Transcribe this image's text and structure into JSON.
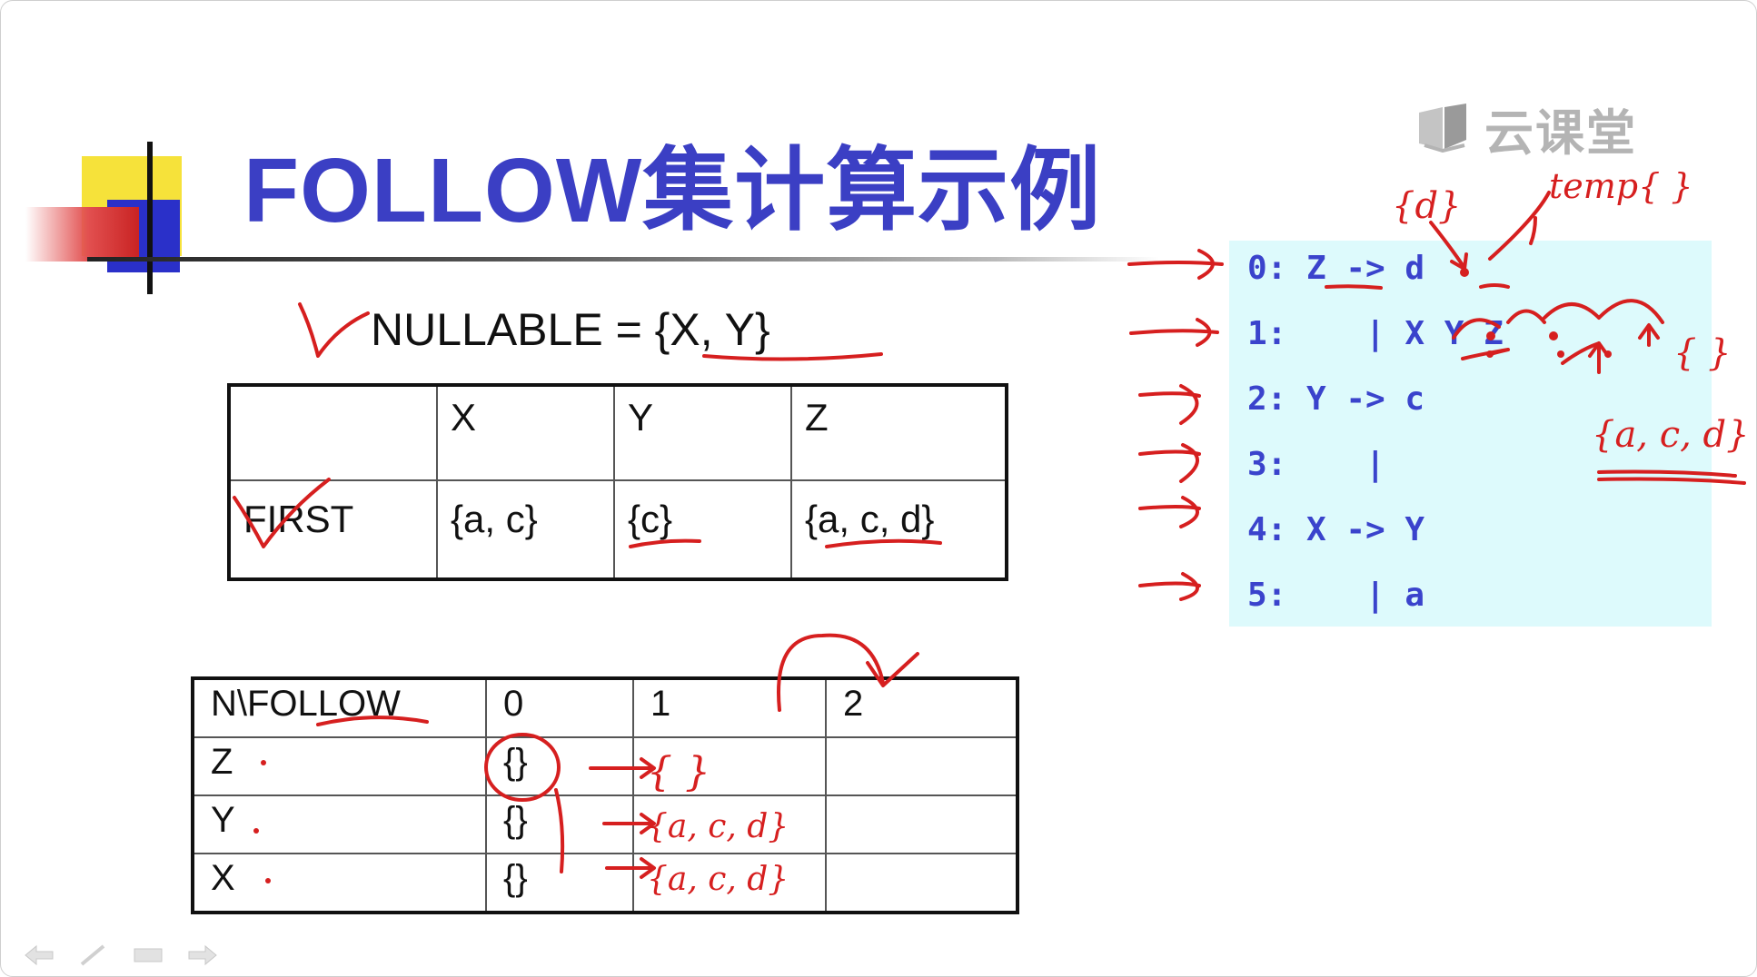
{
  "slide": {
    "title": "FOLLOW集计算示例",
    "watermark": "云课堂",
    "nullable": "NULLABLE = {X, Y}"
  },
  "first_table": {
    "header": [
      "",
      "X",
      "Y",
      "Z"
    ],
    "rows": [
      [
        "FIRST",
        "{a, c}",
        "{c}",
        "{a, c, d}"
      ]
    ]
  },
  "follow_table": {
    "header": [
      "N\\FOLLOW",
      "0",
      "1",
      "2"
    ],
    "rows": [
      [
        "Z",
        "{}",
        "",
        ""
      ],
      [
        "Y",
        "{}",
        "",
        ""
      ],
      [
        "X",
        "{}",
        "",
        ""
      ]
    ]
  },
  "grammar": [
    "0: Z -> d",
    "1:    | X Y Z",
    "2: Y -> c",
    "3:    |",
    "4: X -> Y",
    "5:    | a"
  ],
  "annotations": {
    "follow_z_1": "{ }",
    "follow_y_1": "{a, c, d}",
    "follow_x_1": "{a, c, d}",
    "grammar_d": "{d}",
    "grammar_temp": "temp{ }",
    "grammar_z": "{ }",
    "grammar_y": "{a, c, d}"
  },
  "colors": {
    "title": "#3b3fc4",
    "grammar_text": "#3a43cc",
    "grammar_bg": "#ddfafc",
    "ink": "#d61f1f"
  }
}
